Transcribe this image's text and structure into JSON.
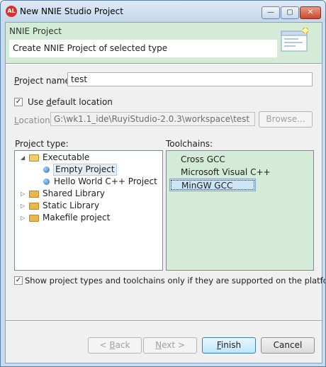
{
  "window": {
    "title": "New NNIE Studio Project",
    "app_icon_text": "AL",
    "controls": {
      "minimize": "—",
      "maximize": "▢",
      "close": "✕"
    }
  },
  "banner": {
    "title": "NNIE Project",
    "message": "Create NNIE Project of selected type"
  },
  "project_name": {
    "label_mnemonic": "P",
    "label_rest": "roject name:",
    "value": "test"
  },
  "use_default_location": {
    "checked": true,
    "mark": "✓",
    "label_pre": "Use ",
    "label_mnemonic": "d",
    "label_rest": "efault location"
  },
  "location": {
    "label_mnemonic": "L",
    "label_rest": "ocation:",
    "value": "G:\\wk1.1_ide\\RuyiStudio-2.0.3\\workspace\\test",
    "browse_label": "Browse..."
  },
  "project_type": {
    "label": "Project type:",
    "expanded_arrow": "◢",
    "collapsed_arrow": "▷",
    "items": [
      {
        "label": "Executable"
      },
      {
        "label": "Empty Project"
      },
      {
        "label": "Hello World C++ Project"
      },
      {
        "label": "Shared Library"
      },
      {
        "label": "Static Library"
      },
      {
        "label": "Makefile project"
      }
    ]
  },
  "toolchains": {
    "label": "Toolchains:",
    "items": [
      {
        "label": "Cross GCC"
      },
      {
        "label": "Microsoft Visual C++"
      },
      {
        "label": "MinGW GCC"
      }
    ],
    "selected": "MinGW GCC"
  },
  "filter_checkbox": {
    "checked": true,
    "mark": "✓",
    "label": "Show project types and toolchains only if they are supported on the platform"
  },
  "buttons": {
    "back": {
      "pre": "< ",
      "mnemonic": "B",
      "rest": "ack"
    },
    "next": {
      "mnemonic": "N",
      "rest": "ext >"
    },
    "finish": {
      "mnemonic": "F",
      "rest": "inish"
    },
    "cancel": "Cancel"
  }
}
